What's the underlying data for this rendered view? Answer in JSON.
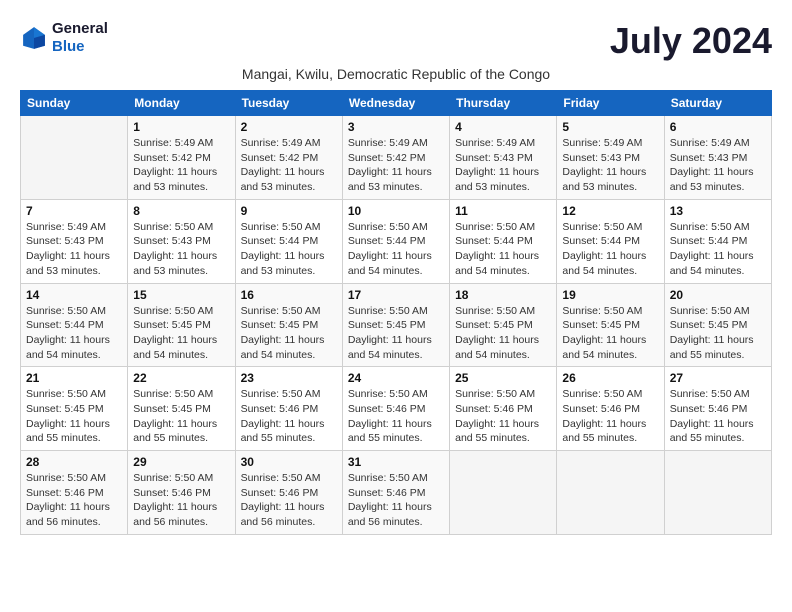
{
  "logo": {
    "line1": "General",
    "line2": "Blue"
  },
  "title": "July 2024",
  "subtitle": "Mangai, Kwilu, Democratic Republic of the Congo",
  "days_of_week": [
    "Sunday",
    "Monday",
    "Tuesday",
    "Wednesday",
    "Thursday",
    "Friday",
    "Saturday"
  ],
  "weeks": [
    [
      {
        "day": "",
        "sunrise": "",
        "sunset": "",
        "daylight": ""
      },
      {
        "day": "1",
        "sunrise": "Sunrise: 5:49 AM",
        "sunset": "Sunset: 5:42 PM",
        "daylight": "Daylight: 11 hours and 53 minutes."
      },
      {
        "day": "2",
        "sunrise": "Sunrise: 5:49 AM",
        "sunset": "Sunset: 5:42 PM",
        "daylight": "Daylight: 11 hours and 53 minutes."
      },
      {
        "day": "3",
        "sunrise": "Sunrise: 5:49 AM",
        "sunset": "Sunset: 5:42 PM",
        "daylight": "Daylight: 11 hours and 53 minutes."
      },
      {
        "day": "4",
        "sunrise": "Sunrise: 5:49 AM",
        "sunset": "Sunset: 5:43 PM",
        "daylight": "Daylight: 11 hours and 53 minutes."
      },
      {
        "day": "5",
        "sunrise": "Sunrise: 5:49 AM",
        "sunset": "Sunset: 5:43 PM",
        "daylight": "Daylight: 11 hours and 53 minutes."
      },
      {
        "day": "6",
        "sunrise": "Sunrise: 5:49 AM",
        "sunset": "Sunset: 5:43 PM",
        "daylight": "Daylight: 11 hours and 53 minutes."
      }
    ],
    [
      {
        "day": "7",
        "sunrise": "Sunrise: 5:49 AM",
        "sunset": "Sunset: 5:43 PM",
        "daylight": "Daylight: 11 hours and 53 minutes."
      },
      {
        "day": "8",
        "sunrise": "Sunrise: 5:50 AM",
        "sunset": "Sunset: 5:43 PM",
        "daylight": "Daylight: 11 hours and 53 minutes."
      },
      {
        "day": "9",
        "sunrise": "Sunrise: 5:50 AM",
        "sunset": "Sunset: 5:44 PM",
        "daylight": "Daylight: 11 hours and 53 minutes."
      },
      {
        "day": "10",
        "sunrise": "Sunrise: 5:50 AM",
        "sunset": "Sunset: 5:44 PM",
        "daylight": "Daylight: 11 hours and 54 minutes."
      },
      {
        "day": "11",
        "sunrise": "Sunrise: 5:50 AM",
        "sunset": "Sunset: 5:44 PM",
        "daylight": "Daylight: 11 hours and 54 minutes."
      },
      {
        "day": "12",
        "sunrise": "Sunrise: 5:50 AM",
        "sunset": "Sunset: 5:44 PM",
        "daylight": "Daylight: 11 hours and 54 minutes."
      },
      {
        "day": "13",
        "sunrise": "Sunrise: 5:50 AM",
        "sunset": "Sunset: 5:44 PM",
        "daylight": "Daylight: 11 hours and 54 minutes."
      }
    ],
    [
      {
        "day": "14",
        "sunrise": "Sunrise: 5:50 AM",
        "sunset": "Sunset: 5:44 PM",
        "daylight": "Daylight: 11 hours and 54 minutes."
      },
      {
        "day": "15",
        "sunrise": "Sunrise: 5:50 AM",
        "sunset": "Sunset: 5:45 PM",
        "daylight": "Daylight: 11 hours and 54 minutes."
      },
      {
        "day": "16",
        "sunrise": "Sunrise: 5:50 AM",
        "sunset": "Sunset: 5:45 PM",
        "daylight": "Daylight: 11 hours and 54 minutes."
      },
      {
        "day": "17",
        "sunrise": "Sunrise: 5:50 AM",
        "sunset": "Sunset: 5:45 PM",
        "daylight": "Daylight: 11 hours and 54 minutes."
      },
      {
        "day": "18",
        "sunrise": "Sunrise: 5:50 AM",
        "sunset": "Sunset: 5:45 PM",
        "daylight": "Daylight: 11 hours and 54 minutes."
      },
      {
        "day": "19",
        "sunrise": "Sunrise: 5:50 AM",
        "sunset": "Sunset: 5:45 PM",
        "daylight": "Daylight: 11 hours and 54 minutes."
      },
      {
        "day": "20",
        "sunrise": "Sunrise: 5:50 AM",
        "sunset": "Sunset: 5:45 PM",
        "daylight": "Daylight: 11 hours and 55 minutes."
      }
    ],
    [
      {
        "day": "21",
        "sunrise": "Sunrise: 5:50 AM",
        "sunset": "Sunset: 5:45 PM",
        "daylight": "Daylight: 11 hours and 55 minutes."
      },
      {
        "day": "22",
        "sunrise": "Sunrise: 5:50 AM",
        "sunset": "Sunset: 5:45 PM",
        "daylight": "Daylight: 11 hours and 55 minutes."
      },
      {
        "day": "23",
        "sunrise": "Sunrise: 5:50 AM",
        "sunset": "Sunset: 5:46 PM",
        "daylight": "Daylight: 11 hours and 55 minutes."
      },
      {
        "day": "24",
        "sunrise": "Sunrise: 5:50 AM",
        "sunset": "Sunset: 5:46 PM",
        "daylight": "Daylight: 11 hours and 55 minutes."
      },
      {
        "day": "25",
        "sunrise": "Sunrise: 5:50 AM",
        "sunset": "Sunset: 5:46 PM",
        "daylight": "Daylight: 11 hours and 55 minutes."
      },
      {
        "day": "26",
        "sunrise": "Sunrise: 5:50 AM",
        "sunset": "Sunset: 5:46 PM",
        "daylight": "Daylight: 11 hours and 55 minutes."
      },
      {
        "day": "27",
        "sunrise": "Sunrise: 5:50 AM",
        "sunset": "Sunset: 5:46 PM",
        "daylight": "Daylight: 11 hours and 55 minutes."
      }
    ],
    [
      {
        "day": "28",
        "sunrise": "Sunrise: 5:50 AM",
        "sunset": "Sunset: 5:46 PM",
        "daylight": "Daylight: 11 hours and 56 minutes."
      },
      {
        "day": "29",
        "sunrise": "Sunrise: 5:50 AM",
        "sunset": "Sunset: 5:46 PM",
        "daylight": "Daylight: 11 hours and 56 minutes."
      },
      {
        "day": "30",
        "sunrise": "Sunrise: 5:50 AM",
        "sunset": "Sunset: 5:46 PM",
        "daylight": "Daylight: 11 hours and 56 minutes."
      },
      {
        "day": "31",
        "sunrise": "Sunrise: 5:50 AM",
        "sunset": "Sunset: 5:46 PM",
        "daylight": "Daylight: 11 hours and 56 minutes."
      },
      {
        "day": "",
        "sunrise": "",
        "sunset": "",
        "daylight": ""
      },
      {
        "day": "",
        "sunrise": "",
        "sunset": "",
        "daylight": ""
      },
      {
        "day": "",
        "sunrise": "",
        "sunset": "",
        "daylight": ""
      }
    ]
  ]
}
